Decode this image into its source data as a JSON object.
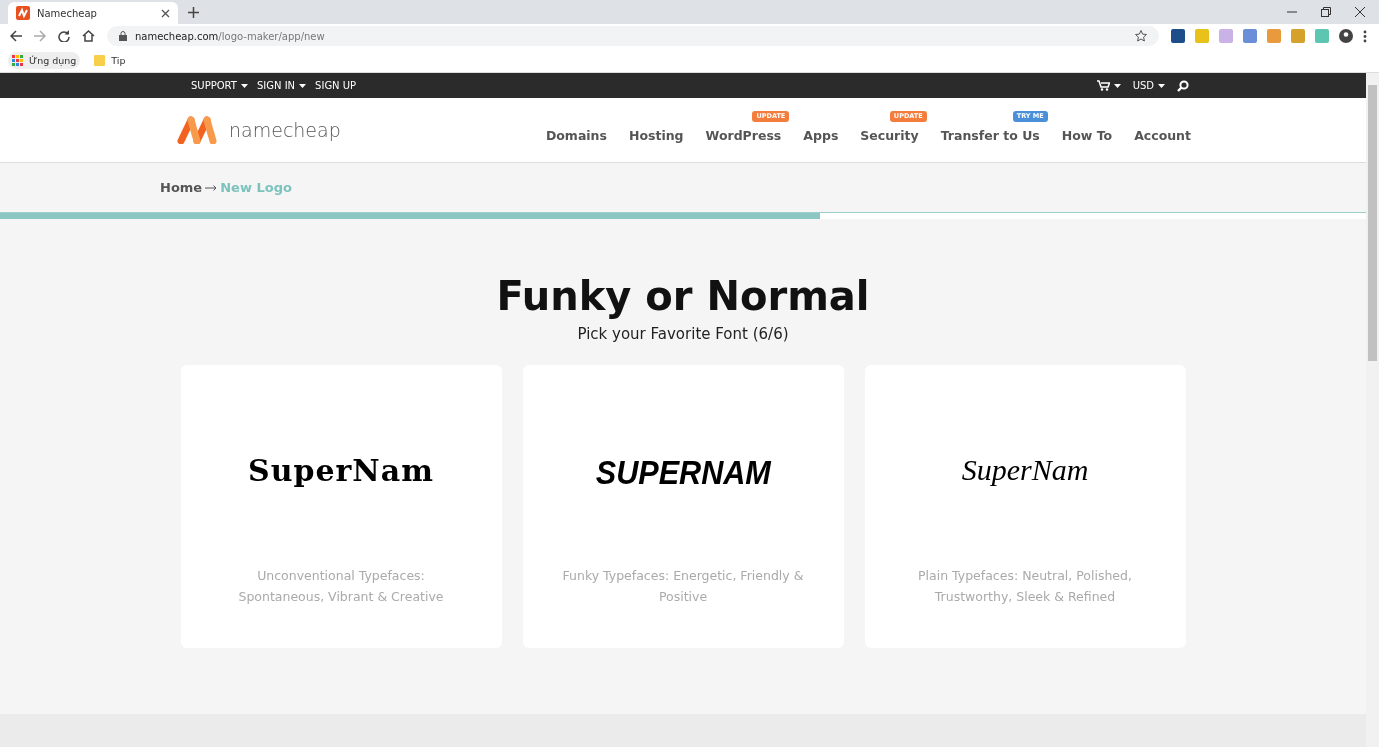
{
  "browser": {
    "tab_title": "Namecheap",
    "url_host": "namecheap.com",
    "url_path": "/logo-maker/app/new",
    "bookmarks": [
      "Ứng dụng",
      "Tip"
    ]
  },
  "topbar": {
    "left": [
      {
        "label": "SUPPORT",
        "dropdown": true
      },
      {
        "label": "SIGN IN",
        "dropdown": true
      },
      {
        "label": "SIGN UP",
        "dropdown": false
      }
    ],
    "currency": "USD"
  },
  "header": {
    "logo_text": "namecheap",
    "nav": [
      {
        "label": "Domains"
      },
      {
        "label": "Hosting"
      },
      {
        "label": "WordPress",
        "badge": {
          "text": "UPDATE",
          "kind": "update"
        }
      },
      {
        "label": "Apps"
      },
      {
        "label": "Security",
        "badge": {
          "text": "UPDATE",
          "kind": "update"
        }
      },
      {
        "label": "Transfer to Us",
        "badge": {
          "text": "TRY ME",
          "kind": "try"
        }
      },
      {
        "label": "How To"
      },
      {
        "label": "Account"
      }
    ]
  },
  "breadcrumb": {
    "home": "Home",
    "current": "New Logo"
  },
  "progress": {
    "level": 0.6
  },
  "main": {
    "title": "Funky or Normal",
    "subtitle": "Pick your Favorite Font (6/6)",
    "cards": [
      {
        "kind": "blackletter",
        "sample": "SuperNam",
        "description": "Unconventional Typefaces: Spontaneous, Vibrant & Creative"
      },
      {
        "kind": "brush",
        "sample": "SUPERNAM",
        "description": "Funky Typefaces: Energetic, Friendly & Positive"
      },
      {
        "kind": "script",
        "sample": "SuperNam",
        "description": "Plain Typefaces: Neutral, Polished, Trustworthy, Sleek & Refined"
      }
    ]
  }
}
